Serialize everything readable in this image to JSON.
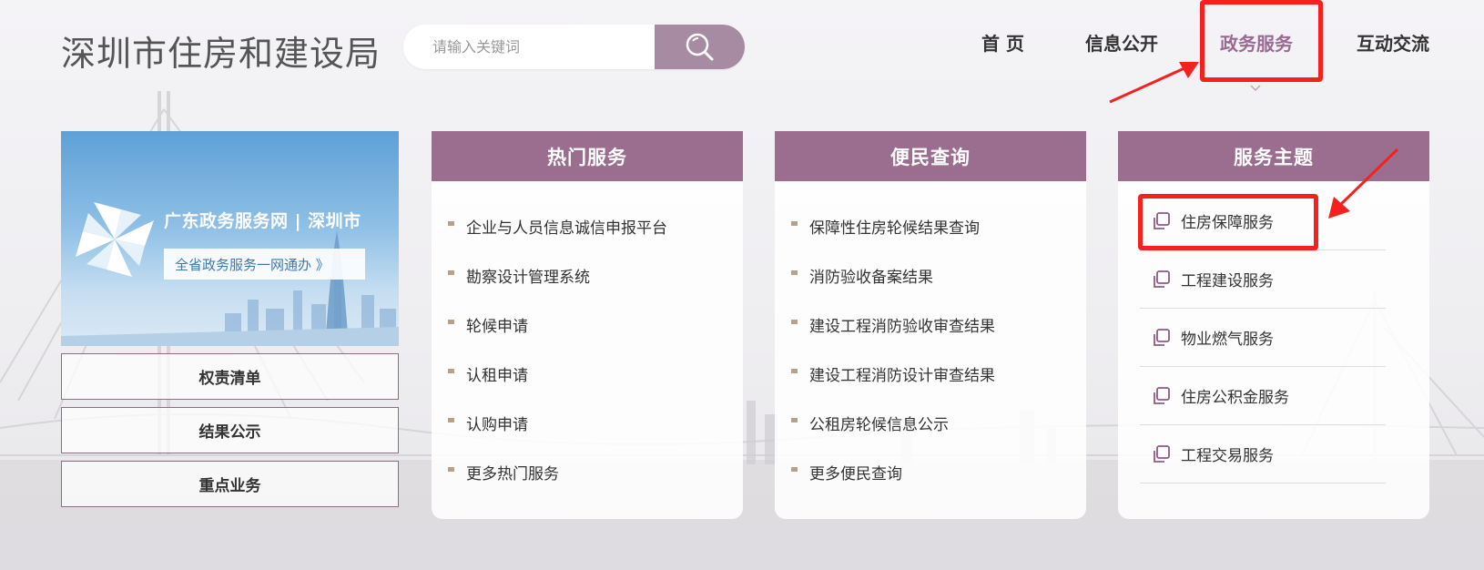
{
  "header": {
    "site_title": "深圳市住房和建设局",
    "search": {
      "placeholder": "请输入关键词",
      "value": ""
    }
  },
  "nav": {
    "items": [
      {
        "label": "首 页"
      },
      {
        "label": "信息公开"
      },
      {
        "label": "政务服务",
        "active": true
      },
      {
        "label": "互动交流"
      }
    ]
  },
  "banner": {
    "title": "广东政务服务网 | 深圳市",
    "subtitle": "全省政务服务一网通办 》"
  },
  "side_buttons": [
    {
      "label": "权责清单"
    },
    {
      "label": "结果公示"
    },
    {
      "label": "重点业务"
    }
  ],
  "panels": {
    "hot": {
      "title": "热门服务",
      "items": [
        "企业与人员信息诚信申报平台",
        "勘察设计管理系统",
        "轮候申请",
        "认租申请",
        "认购申请",
        "更多热门服务"
      ]
    },
    "query": {
      "title": "便民查询",
      "items": [
        "保障性住房轮候结果查询",
        "消防验收备案结果",
        "建设工程消防验收审查结果",
        "建设工程消防设计审查结果",
        "公租房轮候信息公示",
        "更多便民查询"
      ]
    },
    "themes": {
      "title": "服务主题",
      "items": [
        "住房保障服务",
        "工程建设服务",
        "物业燃气服务",
        "住房公积金服务",
        "工程交易服务"
      ]
    }
  },
  "colors": {
    "accent": "#9b6e8f",
    "search_button": "#a78ba3",
    "nav_active": "#9b6a94",
    "annotation_red": "#f5211f"
  }
}
